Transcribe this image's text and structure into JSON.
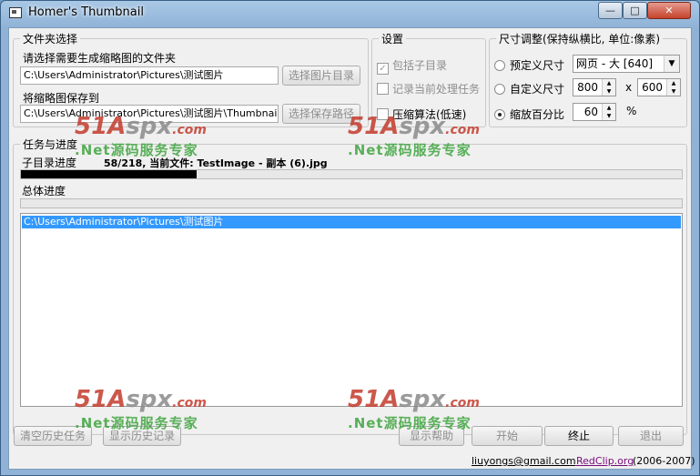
{
  "window": {
    "title": "Homer's Thumbnail"
  },
  "caption_buttons": {
    "minimize": "—",
    "maximize": "□",
    "close": "✕"
  },
  "folder_group": {
    "title": "文件夹选择",
    "source_label": "请选择需要生成缩略图的文件夹",
    "source_path": "C:\\Users\\Administrator\\Pictures\\测试图片",
    "source_button": "选择图片目录",
    "save_label": "将缩略图保存到",
    "save_path": "C:\\Users\\Administrator\\Pictures\\测试图片\\Thumbnails",
    "save_button": "选择保存路径"
  },
  "settings_group": {
    "title": "设置",
    "include_subdirs": "包括子目录",
    "log_current_task": "记录当前处理任务",
    "compress_algorithm": "压缩算法(低速)"
  },
  "size_group": {
    "title": "尺寸调整(保持纵横比, 单位:像素)",
    "preset_label": "预定义尺寸",
    "preset_value": "网页 - 大 [640]",
    "custom_label": "自定义尺寸",
    "custom_width": "800",
    "separator": "x",
    "custom_height": "600",
    "percent_label": "缩放百分比",
    "percent_value": "60",
    "percent_unit": "%"
  },
  "progress_group": {
    "title": "任务与进度",
    "sub_label": "子目录进度",
    "sub_status": "58/218, 当前文件: TestImage - 副本 (6).jpg",
    "sub_progress": 0.266,
    "total_label": "总体进度",
    "total_progress": 0
  },
  "history_list": {
    "items": [
      "C:\\Users\\Administrator\\Pictures\\测试图片"
    ]
  },
  "bottom_buttons": {
    "clear_history": "清空历史任务",
    "show_history": "显示历史记录",
    "show_help": "显示帮助",
    "start": "开始",
    "stop": "终止",
    "exit": "退出"
  },
  "footer": {
    "email": "liuyongs@gmail.com",
    "site": "RedClip.org",
    "years": "(2006-2007)"
  },
  "watermark": {
    "logo_num": "51",
    "logo_a": "A",
    "logo_spx": "spx",
    "logo_com": ".com",
    "tagline": ".Net源码服务专家"
  }
}
